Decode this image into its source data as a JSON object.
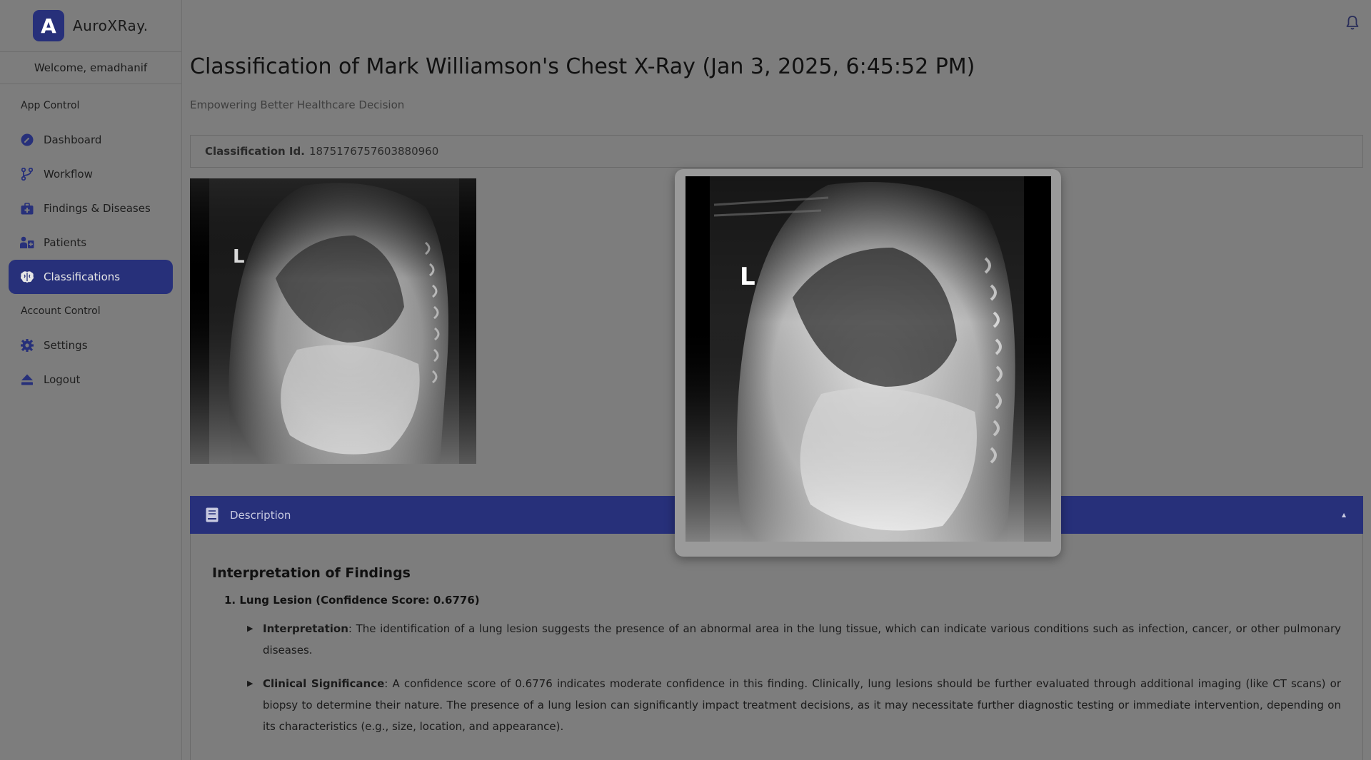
{
  "app": {
    "logo_letter": "A",
    "name": "AuroXRay."
  },
  "sidebar": {
    "welcome": "Welcome, emadhanif",
    "sections": [
      {
        "label": "App Control"
      },
      {
        "label": "Account Control"
      }
    ],
    "items": [
      {
        "label": "Dashboard",
        "icon": "dashboard-icon"
      },
      {
        "label": "Workflow",
        "icon": "workflow-icon"
      },
      {
        "label": "Findings & Diseases",
        "icon": "briefcase-medical-icon"
      },
      {
        "label": "Patients",
        "icon": "patients-icon"
      },
      {
        "label": "Classifications",
        "icon": "brain-icon",
        "active": true
      },
      {
        "label": "Settings",
        "icon": "gear-icon"
      },
      {
        "label": "Logout",
        "icon": "eject-icon"
      }
    ]
  },
  "header": {
    "title": "Classification of Mark Williamson's Chest X-Ray (Jan 3, 2025, 6:45:52 PM)",
    "subtitle": "Empowering Better Healthcare Decision"
  },
  "classification": {
    "id_label": "Classification Id.",
    "id_value": "1875176757603880960"
  },
  "xray": {
    "marker": "L"
  },
  "description": {
    "header": "Description",
    "heading": "Interpretation of Findings",
    "finding_title": "1. Lung Lesion (Confidence Score: 0.6776)",
    "items": [
      {
        "label": "Interpretation",
        "text": ": The identification of a lung lesion suggests the presence of an abnormal area in the lung tissue, which can indicate various conditions such as infection, cancer, or other pulmonary diseases."
      },
      {
        "label": "Clinical Significance",
        "text": ": A confidence score of 0.6776 indicates moderate confidence in this finding. Clinically, lung lesions should be further evaluated through additional imaging (like CT scans) or biopsy to determine their nature. The presence of a lung lesion can significantly impact treatment decisions, as it may necessitate further diagnostic testing or immediate intervention, depending on its characteristics (e.g., size, location, and appearance)."
      }
    ]
  },
  "colors": {
    "accent": "#27307a",
    "overlay_bg": "#7d7d7d"
  }
}
